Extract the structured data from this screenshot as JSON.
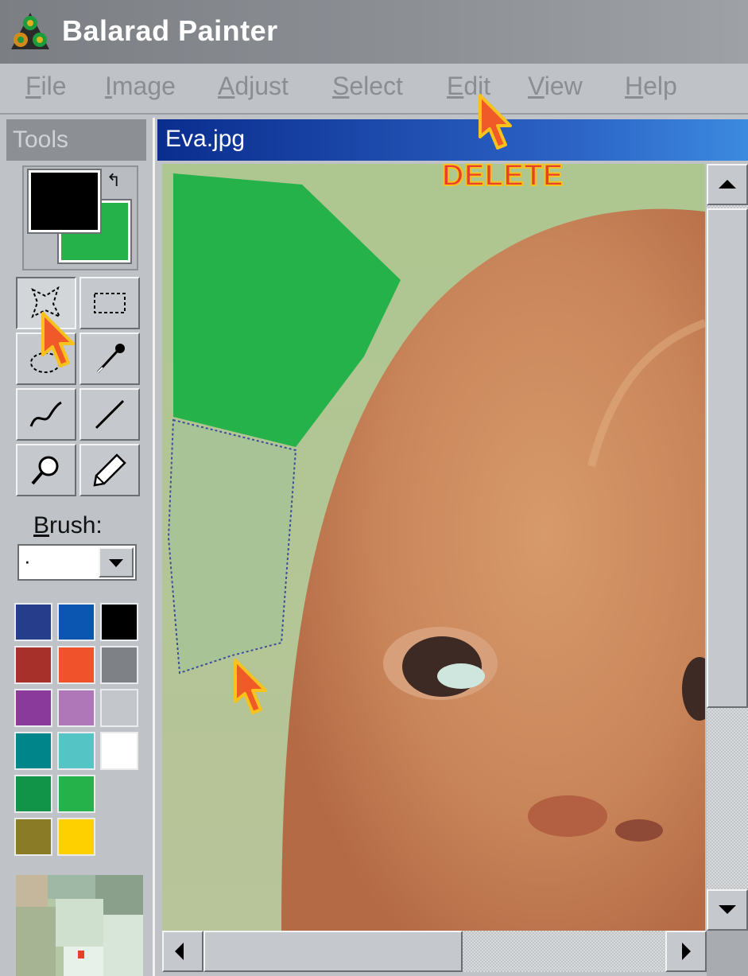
{
  "app": {
    "title": "Balarad Painter"
  },
  "menu": {
    "items": [
      "File",
      "Image",
      "Adjust",
      "Select",
      "Edit",
      "View",
      "Help"
    ]
  },
  "tools": {
    "header": "Tools",
    "foreground_color": "#000000",
    "background_color": "#25b24b",
    "buttons": [
      "freeform-select",
      "rectangle-select",
      "lasso",
      "eyedropper",
      "curve",
      "line",
      "magnifier",
      "pencil"
    ],
    "active_tool": "freeform-select"
  },
  "brush": {
    "label": "Brush:",
    "value": "·"
  },
  "palette": [
    "#253d8a",
    "#0a56b0",
    "#000000",
    "#a8302a",
    "#f0522c",
    "#7e8287",
    "#8a3a9a",
    "#b077b8",
    "#c3c7cb",
    "#00868a",
    "#54c4c4",
    "#ffffff",
    "#129448",
    "#25b24b",
    "#8a7c26",
    "#ffd000"
  ],
  "document": {
    "title": "Eva.jpg"
  },
  "annotation": {
    "text": "DELETE"
  }
}
